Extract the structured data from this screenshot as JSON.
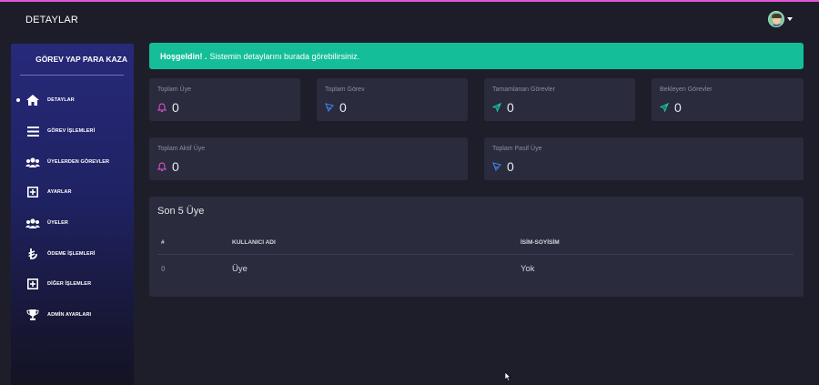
{
  "header": {
    "title": "DETAYLAR",
    "avatar_icon": "user-avatar"
  },
  "sidebar": {
    "brand": "GÖREV YAP PARA KAZA",
    "items": [
      {
        "label": "DETAYLAR",
        "icon": "home-icon",
        "active": true
      },
      {
        "label": "GÖREV İŞLEMLERİ",
        "icon": "list-icon"
      },
      {
        "label": "ÜYELERDEN GÖREVLER",
        "icon": "users-icon"
      },
      {
        "label": "AYARLAR",
        "icon": "plus-square-icon"
      },
      {
        "label": "ÜYELER",
        "icon": "users-icon"
      },
      {
        "label": "ÖDEME İŞLEMLERİ",
        "icon": "lira-icon"
      },
      {
        "label": "DİĞER İŞLEMLER",
        "icon": "plus-square-icon"
      },
      {
        "label": "ADMİN AYARLARI",
        "icon": "trophy-icon"
      }
    ]
  },
  "alert": {
    "strong": "Hoşgeldin! .",
    "text": "Sistemin detaylarını burada görebilirsiniz."
  },
  "stats": [
    {
      "label": "Toplam Üye",
      "value": "0",
      "icon": "bell-icon",
      "color": "#e057d6"
    },
    {
      "label": "Toplam Görev",
      "value": "0",
      "icon": "rocket-icon",
      "color": "#3f7fe8"
    },
    {
      "label": "Tamamlanan Görevler",
      "value": "0",
      "icon": "send-icon",
      "color": "#17c6a3"
    },
    {
      "label": "Bekleyen Görevler",
      "value": "0",
      "icon": "send-icon",
      "color": "#17c6a3"
    },
    {
      "label": "Toplam Aktif Üye",
      "value": "0",
      "icon": "bell-icon",
      "color": "#e057d6"
    },
    {
      "label": "Toplam Pasif Üye",
      "value": "0",
      "icon": "rocket-icon",
      "color": "#3f7fe8"
    }
  ],
  "table": {
    "title": "Son 5 Üye",
    "headers": [
      "#",
      "KULLANICI ADI",
      "İSİM-SOYİSİM"
    ],
    "rows": [
      [
        "0",
        "Üye",
        "Yok"
      ]
    ]
  },
  "colors": {
    "accent": "#14be99",
    "background": "#1e1e2b",
    "card": "#2a2b3c",
    "topline": "#e057d6"
  }
}
